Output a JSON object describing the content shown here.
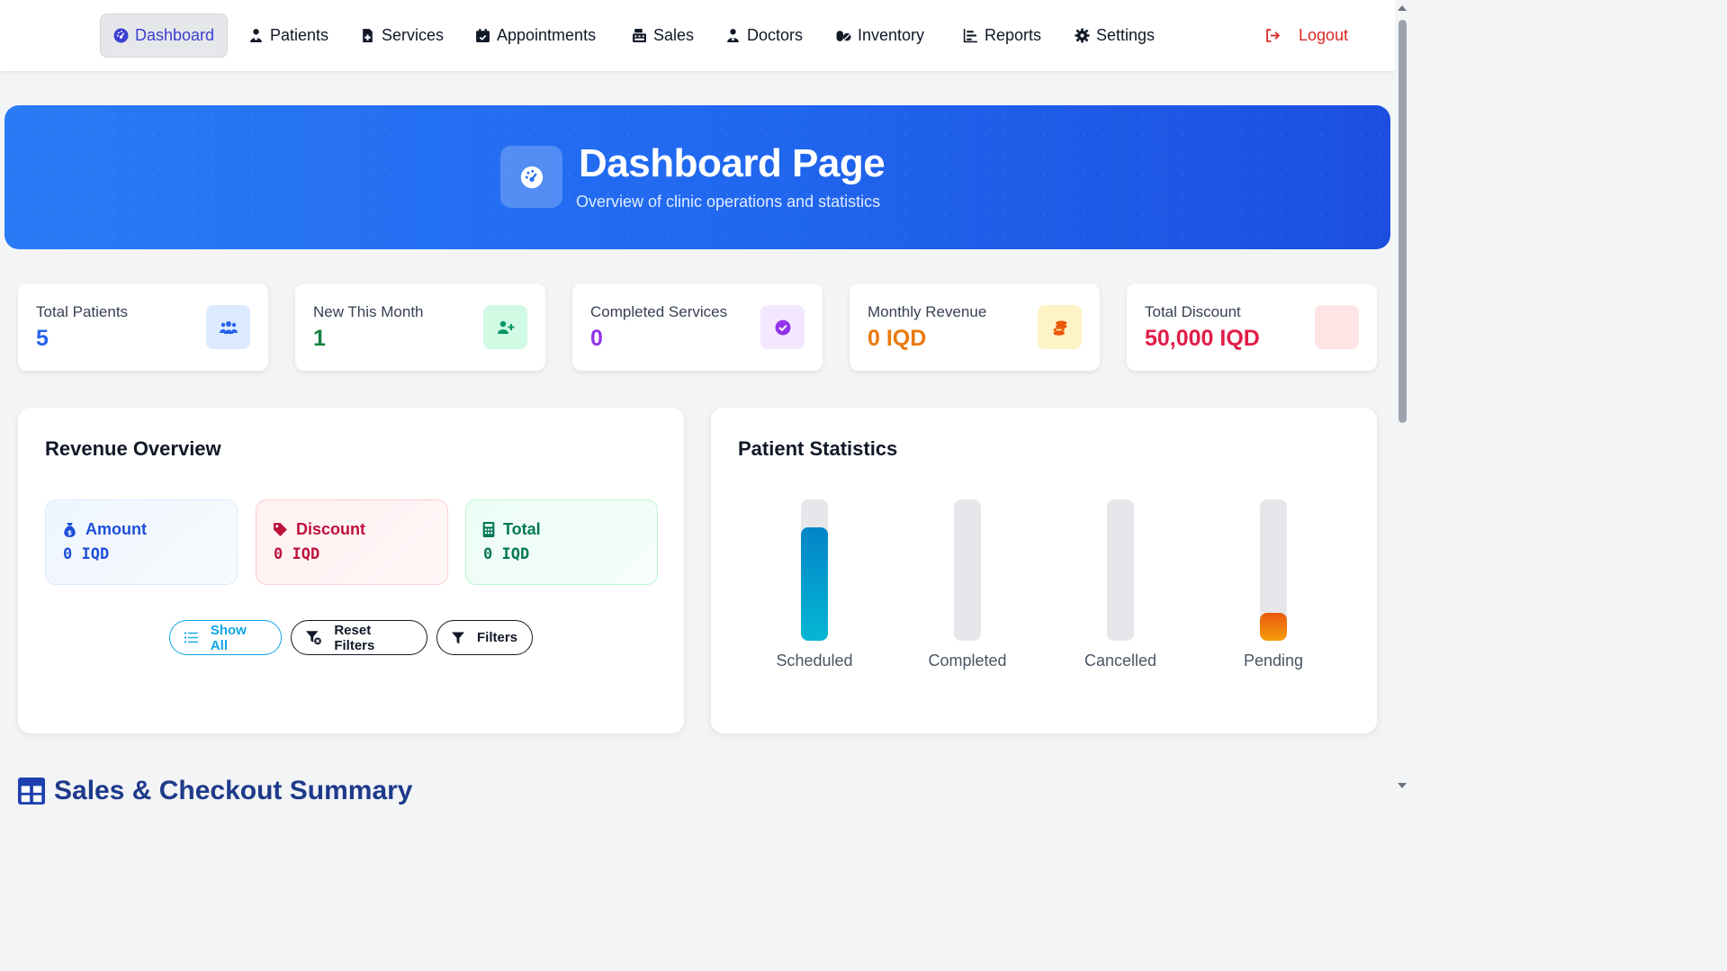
{
  "nav": {
    "items": [
      {
        "label": "Dashboard",
        "icon": "gauge-icon"
      },
      {
        "label": "Patients",
        "icon": "person-icon"
      },
      {
        "label": "Services",
        "icon": "file-medical-icon"
      },
      {
        "label": "Appointments",
        "icon": "calendar-check-icon"
      },
      {
        "label": "Sales",
        "icon": "cash-register-icon"
      },
      {
        "label": "Doctors",
        "icon": "doctor-icon"
      },
      {
        "label": "Inventory",
        "icon": "pills-icon"
      },
      {
        "label": "Reports",
        "icon": "chart-bar-icon"
      },
      {
        "label": "Settings",
        "icon": "gear-icon"
      }
    ],
    "logout": "Logout",
    "active": "Dashboard"
  },
  "hero": {
    "title": "Dashboard Page",
    "subtitle": "Overview of clinic operations and statistics",
    "icon": "gauge-icon"
  },
  "stats": [
    {
      "label": "Total Patients",
      "value": "5",
      "color": "#2563eb",
      "icon": "users-icon",
      "icon_bg": "#dbeafe",
      "icon_color": "#2563eb"
    },
    {
      "label": "New This Month",
      "value": "1",
      "color": "#15803d",
      "icon": "user-plus-icon",
      "icon_bg": "#d1fae5",
      "icon_color": "#059669"
    },
    {
      "label": "Completed Services",
      "value": "0",
      "color": "#9333ea",
      "icon": "check-circle-icon",
      "icon_bg": "#f3e8ff",
      "icon_color": "#9333ea"
    },
    {
      "label": "Monthly Revenue",
      "value": "0 IQD",
      "color": "#ea7a0c",
      "icon": "coins-icon",
      "icon_bg": "#fef3c7",
      "icon_color": "#ea580c"
    },
    {
      "label": "Total Discount",
      "value": "50,000 IQD",
      "color": "#e11d48",
      "icon": "",
      "icon_bg": "#ffe4e6",
      "icon_color": "#e11d48"
    }
  ],
  "revenue": {
    "title": "Revenue Overview",
    "boxes": [
      {
        "label": "Amount",
        "value": "0 IQD",
        "icon": "money-bag-icon",
        "color": "#1d4ed8"
      },
      {
        "label": "Discount",
        "value": "0 IQD",
        "icon": "tag-icon",
        "color": "#be123c"
      },
      {
        "label": "Total",
        "value": "0 IQD",
        "icon": "calculator-icon",
        "color": "#047857"
      }
    ],
    "buttons": {
      "show_all": "Show All",
      "reset_filters": "Reset Filters",
      "filters": "Filters"
    }
  },
  "patient_stats": {
    "title": "Patient Statistics",
    "bars": [
      {
        "label": "Scheduled",
        "fraction": 0.8
      },
      {
        "label": "Completed",
        "fraction": 0
      },
      {
        "label": "Cancelled",
        "fraction": 0
      },
      {
        "label": "Pending",
        "fraction": 0.2
      }
    ]
  },
  "next_section": {
    "title": "Sales & Checkout Summary"
  }
}
